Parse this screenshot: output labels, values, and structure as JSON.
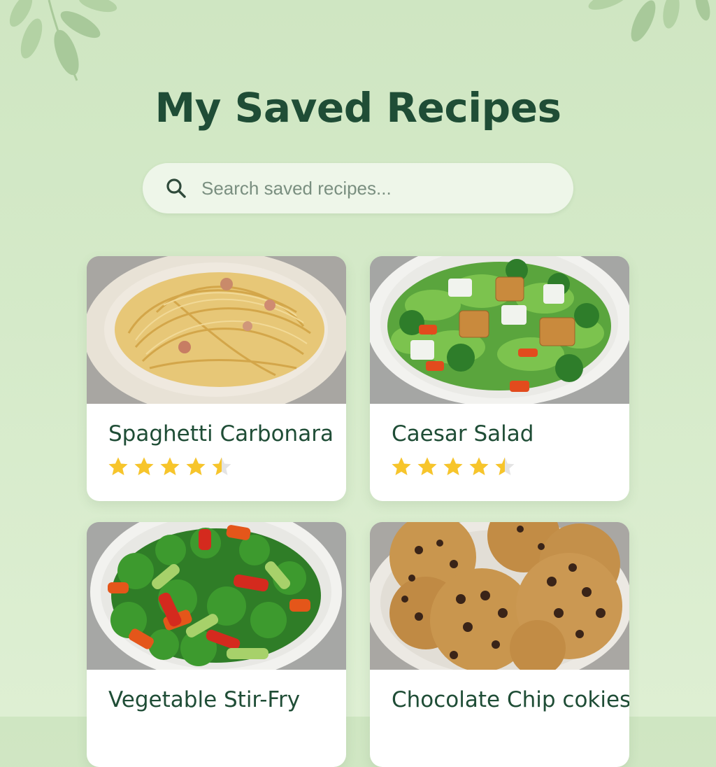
{
  "page": {
    "title": "My Saved Recipes"
  },
  "search": {
    "placeholder": "Search saved recipes...",
    "value": ""
  },
  "icons": {
    "search": "search-icon",
    "star": "star-icon",
    "leaf": "leaf-decoration"
  },
  "colors": {
    "title": "#1f4d36",
    "star": "#f7c52b",
    "background": "#d3e8c7"
  },
  "recipes": [
    {
      "name": "Spaghetti Carbonara",
      "rating": 4.5,
      "rating_max": 5,
      "image": "spaghetti-carbonara-photo"
    },
    {
      "name": "Caesar Salad",
      "rating": 4.5,
      "rating_max": 5,
      "image": "caesar-salad-photo"
    },
    {
      "name": "Vegetable Stir-Fry",
      "image": "vegetable-stir-fry-photo"
    },
    {
      "name": "Chocolate Chip cokies",
      "image": "chocolate-chip-cookies-photo"
    }
  ]
}
